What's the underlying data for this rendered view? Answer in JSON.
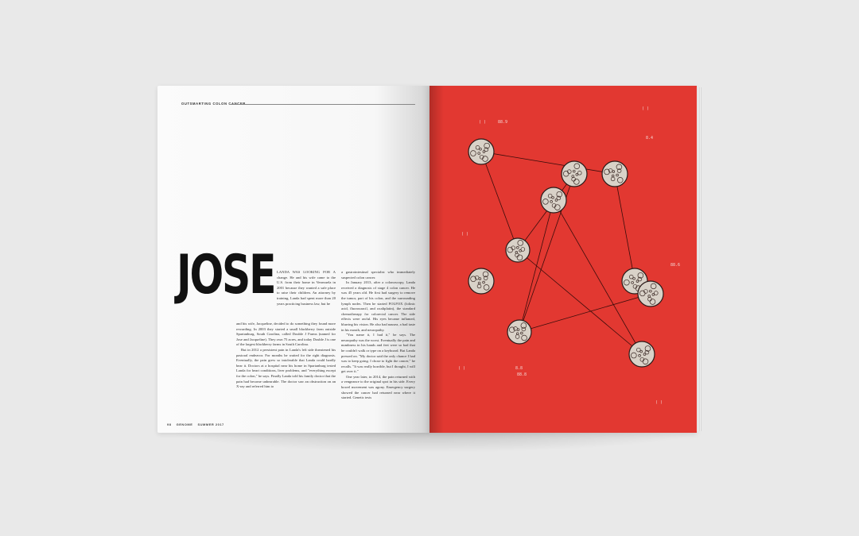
{
  "section_label": "OUTSMARTING COLON CANCER",
  "headline": "JOSE",
  "column_a_top": "LANDA WAS LOOKING FOR A change. He and his wife came to the U.S. from their home in Venezuela in 2001 because they wanted a safe place to raise their children. An attorney by training, Landa had spent more than 20 years practicing business law, but he",
  "column_a_bottom": [
    "and his wife, Jacqueline, decided to do something they found more rewarding. In 2003 they started a small blackberry farm outside Spartanburg, South Carolina, called Double J Farms (named for Jose and Jacqueline). They own 75 acres, and today Double J is one of the largest blackberry farms in South Carolina.",
    "But in 2012 a persistent pain in Landa's left side threatened his pastoral endeavor. For months he waited for the right diagnosis. Eventually, the pain grew so intolerable that Landa could hardly bear it. Doctors at a hospital near his home in Spartanburg tested Landa for heart conditions, liver problems, and \"everything except for the colon,\" he says. Finally Landa told his family doctor that the pain had become unbearable. The doctor saw an obstruction on an X-ray and referred him to"
  ],
  "column_b": [
    "a gastrointestinal specialist who immediately suspected colon cancer.",
    "In January 2013, after a colonoscopy, Landa received a diagnosis of stage 4 colon cancer. He was 45 years old. He first had surgery to remove the tumor, part of his colon, and the surrounding lymph nodes. Then he started FOLFOX (folinic acid, fluorouracil, and oxaliplatin), the standard chemotherapy for colorectal cancer. The side effects were awful. His eyes became inflamed, blurring his vision. He also had nausea, a bad taste in his mouth, and neuropathy.",
    "\"You name it, I had it,\" he says. The neuropathy was the worst. Eventually the pain and numbness in his hands and feet were so bad that he couldn't walk or type on a keyboard. But Landa pressed on. \"My doctor said the only chance I had was to keep going. I chose to fight the cancer,\" he recalls. \"It was really horrible, but I thought, I will get over it.\"",
    "One year later, in 2014, the pain returned with a vengeance to the original spot in his side. Every bowel movement was agony. Emergency surgery showed the cancer had returned near where it started. Genetic tests"
  ],
  "folio": {
    "page_number": "98",
    "magazine": "GENOME",
    "issue": "SUMMER 2017"
  },
  "illustration": {
    "background_color": "#e23831",
    "line_color": "#3a0d0b",
    "cell_fill": "#d9d2c8",
    "cell_stroke": "#2a1a18",
    "annotations": [
      "( )",
      "88.9",
      "( )",
      "8.4",
      "88.6",
      "( )",
      "( )",
      "8.8",
      "88.8",
      "( )"
    ]
  }
}
